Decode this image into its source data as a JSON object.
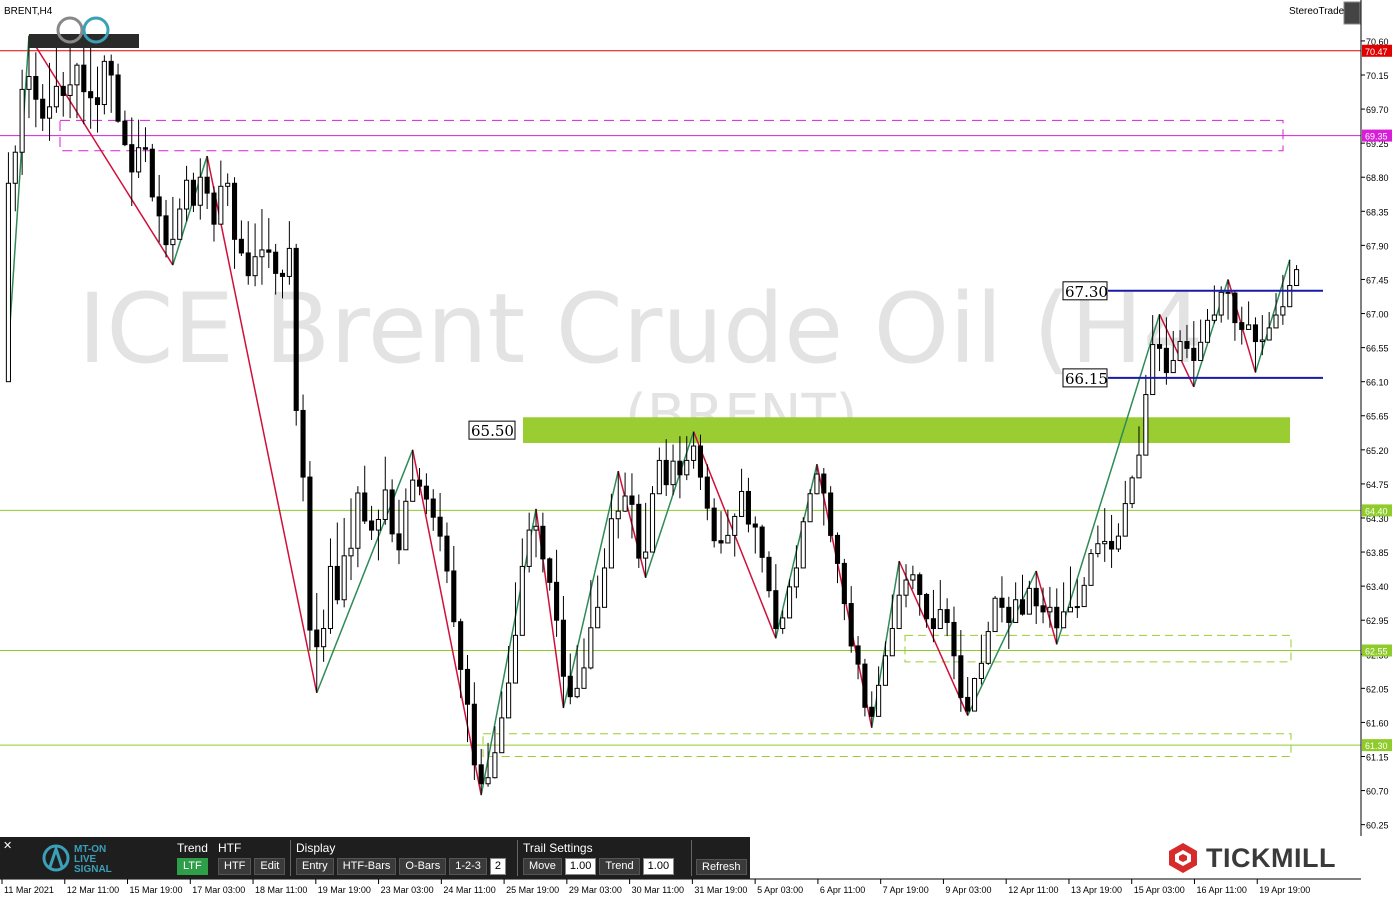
{
  "chart_data": {
    "type": "candlestick",
    "symbol_label": "BRENT,H4",
    "watermark_title": "ICE Brent Crude Oil (H4",
    "watermark_subtitle": "(BRENT)",
    "yaxis": {
      "ylim": [
        60.1,
        70.85
      ],
      "ticks": [
        "70.60",
        "70.15",
        "69.70",
        "69.25",
        "68.80",
        "68.35",
        "67.90",
        "67.45",
        "67.00",
        "66.55",
        "66.10",
        "65.65",
        "65.20",
        "64.75",
        "64.30",
        "63.85",
        "63.40",
        "62.95",
        "62.50",
        "62.05",
        "61.60",
        "61.15",
        "60.70",
        "60.25"
      ]
    },
    "xaxis_labels": [
      "11 Mar 2021",
      "12 Mar 11:00",
      "15 Mar 19:00",
      "17 Mar 03:00",
      "18 Mar 11:00",
      "19 Mar 19:00",
      "23 Mar 03:00",
      "24 Mar 11:00",
      "25 Mar 19:00",
      "29 Mar 03:00",
      "30 Mar 11:00",
      "31 Mar 19:00",
      "5 Apr 03:00",
      "6 Apr 11:00",
      "7 Apr 19:00",
      "9 Apr 03:00",
      "12 Apr 11:00",
      "13 Apr 19:00",
      "15 Apr 03:00",
      "16 Apr 11:00",
      "19 Apr 19:00"
    ],
    "price_labels": [
      {
        "value": 70.47,
        "text": "70.47",
        "color": "#e00000"
      },
      {
        "value": 69.35,
        "text": "69.35",
        "color": "#d81fd8"
      },
      {
        "value": 64.4,
        "text": "64.40",
        "color": "#8fcb2b"
      },
      {
        "value": 62.55,
        "text": "62.55",
        "color": "#8fcb2b"
      },
      {
        "value": 61.3,
        "text": "61.30",
        "color": "#8fcb2b"
      }
    ],
    "horizontal_lines": [
      {
        "value": 70.47,
        "color": "#e00000"
      },
      {
        "value": 69.35,
        "color": "#d81fd8"
      },
      {
        "value": 64.4,
        "color": "#8fcb2b"
      },
      {
        "value": 62.55,
        "color": "#8fcb2b"
      },
      {
        "value": 61.3,
        "color": "#8fcb2b"
      }
    ],
    "annotations": [
      {
        "text": "67.30",
        "value": 67.3,
        "line_color": "#1a1aa8"
      },
      {
        "text": "66.15",
        "value": 66.15,
        "line_color": "#1a1aa8"
      },
      {
        "text": "65.50",
        "value": 65.5,
        "zone_color": "#9acd32"
      }
    ],
    "candles": [
      [
        66.1,
        68.72,
        69.13,
        66.53
      ],
      [
        68.72,
        69.13,
        69.22,
        68.35
      ],
      [
        69.13,
        69.96,
        70.22,
        68.83
      ],
      [
        69.96,
        70.13,
        70.67,
        69.58
      ],
      [
        70.13,
        69.83,
        70.45,
        69.46
      ],
      [
        69.83,
        69.58,
        70.03,
        69.41
      ],
      [
        69.58,
        69.73,
        70.31,
        69.28
      ],
      [
        69.73,
        70.0,
        70.52,
        69.65
      ],
      [
        70.0,
        69.88,
        70.19,
        69.6
      ],
      [
        69.88,
        70.02,
        70.61,
        69.58
      ],
      [
        70.02,
        70.28,
        70.31,
        69.58
      ],
      [
        70.28,
        69.93,
        70.51,
        69.5
      ],
      [
        69.93,
        69.85,
        70.53,
        69.44
      ],
      [
        69.85,
        69.76,
        70.26,
        69.39
      ],
      [
        69.76,
        70.33,
        70.41,
        69.63
      ],
      [
        70.33,
        70.15,
        70.42,
        69.65
      ],
      [
        70.15,
        69.54,
        70.3,
        69.52
      ],
      [
        69.54,
        69.23,
        69.68,
        69.21
      ],
      [
        69.23,
        68.87,
        69.59,
        68.42
      ],
      [
        68.87,
        69.19,
        69.56,
        68.79
      ],
      [
        69.19,
        69.17,
        69.46,
        69.0
      ],
      [
        69.17,
        68.54,
        69.24,
        68.48
      ],
      [
        68.54,
        68.29,
        68.83,
        67.94
      ],
      [
        68.29,
        67.91,
        68.5,
        67.74
      ],
      [
        67.91,
        67.98,
        68.54,
        67.64
      ],
      [
        67.98,
        68.38,
        68.52,
        68.29
      ],
      [
        68.38,
        68.76,
        68.95,
        68.22
      ],
      [
        68.76,
        68.43,
        68.86,
        68.34
      ],
      [
        68.43,
        68.8,
        69.05,
        68.24
      ],
      [
        68.8,
        68.59,
        69.08,
        68.38
      ],
      [
        68.59,
        68.18,
        68.68,
        67.95
      ],
      [
        68.18,
        68.68,
        69.02,
        68.53
      ],
      [
        68.68,
        68.72,
        68.85,
        68.42
      ],
      [
        68.72,
        67.98,
        68.8,
        67.59
      ],
      [
        67.98,
        67.8,
        68.23,
        67.76
      ],
      [
        67.8,
        67.5,
        68.22,
        67.38
      ],
      [
        67.5,
        67.75,
        68.19,
        67.36
      ],
      [
        67.75,
        67.84,
        68.38,
        67.38
      ],
      [
        67.84,
        67.81,
        68.26,
        67.6
      ],
      [
        67.81,
        67.53,
        67.92,
        67.25
      ],
      [
        67.53,
        67.49,
        67.58,
        67.2
      ],
      [
        67.49,
        67.86,
        68.22,
        67.38
      ],
      [
        67.86,
        65.72,
        67.92,
        65.52
      ],
      [
        65.72,
        64.84,
        65.93,
        64.52
      ],
      [
        64.84,
        62.82,
        65.05,
        62.55
      ],
      [
        62.82,
        62.6,
        63.31,
        61.99
      ],
      [
        62.6,
        62.84,
        63.09,
        62.4
      ],
      [
        62.84,
        63.66,
        64.03,
        62.77
      ],
      [
        63.66,
        63.22,
        64.24,
        63.16
      ],
      [
        63.22,
        63.8,
        64.3,
        63.12
      ],
      [
        63.8,
        63.9,
        64.56,
        63.48
      ],
      [
        63.9,
        64.63,
        64.72,
        63.65
      ],
      [
        64.63,
        64.26,
        64.99,
        64.22
      ],
      [
        64.26,
        64.14,
        64.46,
        64.01
      ],
      [
        64.14,
        64.28,
        64.41,
        63.74
      ],
      [
        64.28,
        64.67,
        65.11,
        64.21
      ],
      [
        64.67,
        64.09,
        64.81,
        63.98
      ],
      [
        64.09,
        63.88,
        64.54,
        63.69
      ],
      [
        63.88,
        64.52,
        64.69,
        64.23
      ],
      [
        64.52,
        64.8,
        65.2,
        64.54
      ],
      [
        64.8,
        64.72,
        64.96,
        64.6
      ],
      [
        64.72,
        64.55,
        64.89,
        64.35
      ],
      [
        64.55,
        64.31,
        64.68,
        64.13
      ],
      [
        64.31,
        64.06,
        64.63,
        63.86
      ],
      [
        64.06,
        63.6,
        64.24,
        63.44
      ],
      [
        63.6,
        62.93,
        63.93,
        62.86
      ],
      [
        62.93,
        62.3,
        62.97,
        61.92
      ],
      [
        62.3,
        61.84,
        62.49,
        61.34
      ],
      [
        61.84,
        61.04,
        62.13,
        60.84
      ],
      [
        61.04,
        60.79,
        61.25,
        60.64
      ],
      [
        60.79,
        60.87,
        61.33,
        60.75
      ],
      [
        60.87,
        61.2,
        61.55,
        60.86
      ],
      [
        61.2,
        61.66,
        62.01,
        61.59
      ],
      [
        61.66,
        62.12,
        62.61,
        61.89
      ],
      [
        62.12,
        62.75,
        63.45,
        62.57
      ],
      [
        62.75,
        63.66,
        64.03,
        63.59
      ],
      [
        63.66,
        64.14,
        64.37,
        63.58
      ],
      [
        64.14,
        64.19,
        64.42,
        63.78
      ],
      [
        64.19,
        63.76,
        64.37,
        63.58
      ],
      [
        63.76,
        63.45,
        63.78,
        63.34
      ],
      [
        63.45,
        62.95,
        63.88,
        62.73
      ],
      [
        62.95,
        62.21,
        63.27,
        61.79
      ],
      [
        62.21,
        61.94,
        62.51,
        61.84
      ],
      [
        61.94,
        62.05,
        62.62,
        61.92
      ],
      [
        62.05,
        62.32,
        62.71,
        62.08
      ],
      [
        62.32,
        62.85,
        63.48,
        62.3
      ],
      [
        62.85,
        63.12,
        63.54,
        62.98
      ],
      [
        63.12,
        63.64,
        63.9,
        63.61
      ],
      [
        63.64,
        64.29,
        64.62,
        63.97
      ],
      [
        64.29,
        64.39,
        64.92,
        64.03
      ],
      [
        64.39,
        64.59,
        64.9,
        64.38
      ],
      [
        64.59,
        64.48,
        64.89,
        64.03
      ],
      [
        64.48,
        63.77,
        64.61,
        63.64
      ],
      [
        63.77,
        63.85,
        64.5,
        63.51
      ],
      [
        63.85,
        64.62,
        64.72,
        64.26
      ],
      [
        64.62,
        65.06,
        65.23,
        65.05
      ],
      [
        65.06,
        64.74,
        65.34,
        64.59
      ],
      [
        64.74,
        65.05,
        65.27,
        64.6
      ],
      [
        65.05,
        64.87,
        65.38,
        64.56
      ],
      [
        64.87,
        65.06,
        65.38,
        64.8
      ],
      [
        65.06,
        65.25,
        65.44,
        64.95
      ],
      [
        65.25,
        64.84,
        65.4,
        64.67
      ],
      [
        64.84,
        64.43,
        65.01,
        64.27
      ],
      [
        64.43,
        64.0,
        64.56,
        63.91
      ],
      [
        64.0,
        63.97,
        64.39,
        63.83
      ],
      [
        63.97,
        64.07,
        64.41,
        63.99
      ],
      [
        64.07,
        64.32,
        64.36,
        63.79
      ],
      [
        64.32,
        64.65,
        64.95,
        64.56
      ],
      [
        64.65,
        64.22,
        64.83,
        64.11
      ],
      [
        64.22,
        64.18,
        64.32,
        63.83
      ],
      [
        64.18,
        63.78,
        64.21,
        63.58
      ],
      [
        63.78,
        63.34,
        63.86,
        63.25
      ],
      [
        63.34,
        62.84,
        63.69,
        62.71
      ],
      [
        62.84,
        62.98,
        63.08,
        62.77
      ],
      [
        62.98,
        63.39,
        63.49,
        63.38
      ],
      [
        63.39,
        63.64,
        63.94,
        63.24
      ],
      [
        63.64,
        64.25,
        64.31,
        63.73
      ],
      [
        64.25,
        64.62,
        64.68,
        64.37
      ],
      [
        64.62,
        64.88,
        65.01,
        64.61
      ],
      [
        64.88,
        64.63,
        64.96,
        64.2
      ],
      [
        64.63,
        64.07,
        64.72,
        63.98
      ],
      [
        64.07,
        63.7,
        64.11,
        63.44
      ],
      [
        63.7,
        63.17,
        63.76,
        62.95
      ],
      [
        63.17,
        62.61,
        63.4,
        62.52
      ],
      [
        62.61,
        62.37,
        62.74,
        62.17
      ],
      [
        62.37,
        61.8,
        62.44,
        61.68
      ],
      [
        61.8,
        61.68,
        62.01,
        61.53
      ],
      [
        61.68,
        62.09,
        62.34,
        62.02
      ],
      [
        62.09,
        62.48,
        62.67,
        62.13
      ],
      [
        62.48,
        62.84,
        63.29,
        62.75
      ],
      [
        62.84,
        63.28,
        63.73,
        63.03
      ],
      [
        63.28,
        63.48,
        63.69,
        63.12
      ],
      [
        63.48,
        63.55,
        63.67,
        63.36
      ],
      [
        63.55,
        63.29,
        63.58,
        63.01
      ],
      [
        63.29,
        62.97,
        63.31,
        62.85
      ],
      [
        62.97,
        62.84,
        63.35,
        62.66
      ],
      [
        62.84,
        63.09,
        63.48,
        62.96
      ],
      [
        63.09,
        62.92,
        63.24,
        62.74
      ],
      [
        62.92,
        62.48,
        63.13,
        62.17
      ],
      [
        62.48,
        61.93,
        62.82,
        61.74
      ],
      [
        61.93,
        61.75,
        62.2,
        61.69
      ],
      [
        61.75,
        62.18,
        62.19,
        61.99
      ],
      [
        62.18,
        62.38,
        62.76,
        62.1
      ],
      [
        62.38,
        62.8,
        62.93,
        62.36
      ],
      [
        62.8,
        63.24,
        63.27,
        63.15
      ],
      [
        63.24,
        63.12,
        63.53,
        62.92
      ],
      [
        63.12,
        62.92,
        63.26,
        62.57
      ],
      [
        62.92,
        63.22,
        63.45,
        63.07
      ],
      [
        63.22,
        63.03,
        63.55,
        63.01
      ],
      [
        63.03,
        63.37,
        63.47,
        63.1
      ],
      [
        63.37,
        63.14,
        63.6,
        62.9
      ],
      [
        63.14,
        63.06,
        63.38,
        62.91
      ],
      [
        63.06,
        63.12,
        63.39,
        62.85
      ],
      [
        63.12,
        62.85,
        63.37,
        62.63
      ],
      [
        62.85,
        63.06,
        63.45,
        62.86
      ],
      [
        63.06,
        63.12,
        63.66,
        63.09
      ],
      [
        63.12,
        63.13,
        63.49,
        62.98
      ],
      [
        63.13,
        63.41,
        63.52,
        63.16
      ],
      [
        63.41,
        63.83,
        63.89,
        63.79
      ],
      [
        63.83,
        63.96,
        64.2,
        63.78
      ],
      [
        63.96,
        63.99,
        64.43,
        63.72
      ],
      [
        63.99,
        63.89,
        64.34,
        63.64
      ],
      [
        63.89,
        64.06,
        64.23,
        63.85
      ],
      [
        64.06,
        64.49,
        64.79,
        64.3
      ],
      [
        64.49,
        64.83,
        64.86,
        64.43
      ],
      [
        64.83,
        65.13,
        65.51,
        65.03
      ],
      [
        65.13,
        65.93,
        66.19,
        65.75
      ],
      [
        65.93,
        66.59,
        66.98,
        66.41
      ],
      [
        66.59,
        66.54,
        66.99,
        66.24
      ],
      [
        66.54,
        66.22,
        66.95,
        66.06
      ],
      [
        66.22,
        66.38,
        66.77,
        66.33
      ],
      [
        66.38,
        66.63,
        66.78,
        66.39
      ],
      [
        66.63,
        66.54,
        66.85,
        66.41
      ],
      [
        66.54,
        66.38,
        66.9,
        66.03
      ],
      [
        66.38,
        66.62,
        66.92,
        66.58
      ],
      [
        66.62,
        66.91,
        67.06,
        66.72
      ],
      [
        66.91,
        66.98,
        67.37,
        66.87
      ],
      [
        66.98,
        67.28,
        67.36,
        66.88
      ],
      [
        67.28,
        67.27,
        67.45,
        66.92
      ],
      [
        67.27,
        66.88,
        67.31,
        66.64
      ],
      [
        66.88,
        66.79,
        67.09,
        66.59
      ],
      [
        66.79,
        66.85,
        67.16,
        66.79
      ],
      [
        66.85,
        66.63,
        66.95,
        66.22
      ],
      [
        66.63,
        66.65,
        66.98,
        66.45
      ],
      [
        66.65,
        66.81,
        67.02,
        66.67
      ],
      [
        66.81,
        66.98,
        67.27,
        66.83
      ],
      [
        66.98,
        67.09,
        67.51,
        66.85
      ],
      [
        67.09,
        67.37,
        67.71,
        67.3
      ],
      [
        67.37,
        67.58,
        67.64,
        67.48
      ]
    ]
  },
  "header": {
    "symbol": "BRENT,H4",
    "stereotrader_label": "StereoTrader"
  },
  "panel": {
    "close_icon": "close-icon",
    "logo_text_1": "MT-ON",
    "logo_text_2": "LIVE",
    "logo_text_3": "SIGNAL",
    "trend": {
      "title": "Trend",
      "button": "LTF"
    },
    "htf": {
      "title": "HTF",
      "button": "HTF",
      "edit": "Edit"
    },
    "display": {
      "title": "Display",
      "entry": "Entry",
      "htf_bars": "HTF-Bars",
      "o_bars": "O-Bars",
      "one_two_three": "1-2-3",
      "count": "2"
    },
    "trail": {
      "title": "Trail Settings",
      "move": "Move",
      "move_value": "1.00",
      "trend": "Trend",
      "trend_value": "1.00"
    },
    "refresh": "Refresh"
  },
  "brand": {
    "name": "TICKMILL",
    "color": "#d72a2a"
  },
  "colors": {
    "bull_zz": "#2e8b57",
    "bear_zz": "#d0103a",
    "early_zz": "#1a1aa8",
    "zone": "#9acd32"
  }
}
